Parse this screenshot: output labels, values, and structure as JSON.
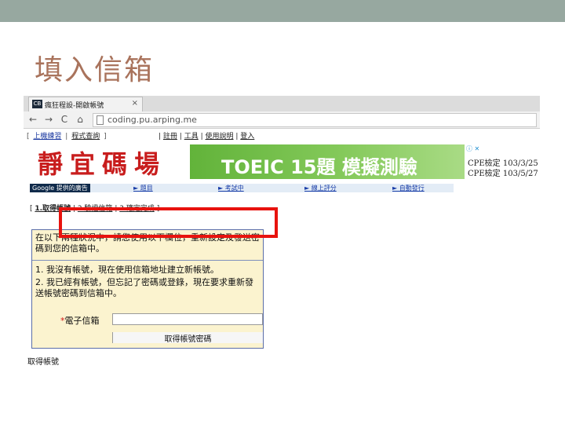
{
  "slide": {
    "title": "填入信箱"
  },
  "browser": {
    "tab_title": "瘋狂程設-開啟帳號",
    "favicon_text": "CB",
    "tab_close": "×",
    "nav": {
      "back": "←",
      "forward": "→",
      "reload": "C",
      "home": "⌂"
    },
    "url": "coding.pu.arping.me"
  },
  "site": {
    "top_links": [
      "上機練習",
      "程式查詢"
    ],
    "user_links": [
      "註冊",
      "工具",
      "使用說明",
      "登入"
    ],
    "logo": "靜宜碼場",
    "banner": "TOEIC 15題 模擬測驗",
    "ad_icons": "ⓘ ✕",
    "cpe_lines": [
      "CPE檢定 103/3/25",
      "CPE檢定 103/5/27"
    ],
    "google_ad_label": "Google 提供的廣告",
    "menu": [
      "► 題目",
      "► 考試中",
      "► 線上評分",
      "► 自動發行"
    ],
    "steps": [
      "1.取得帳號",
      "2.驗證信箱",
      "3.確定完成"
    ]
  },
  "form": {
    "intro": "在以下兩種狀況中，請您使用以下欄位，重新設定及發送密碼到您的信箱中。",
    "option1": "1. 我沒有帳號，現在使用信箱地址建立新帳號。",
    "option2": "2. 我已經有帳號，但忘記了密碼或登錄，現在要求重新發送帳號密碼到信箱中。",
    "email_required_mark": "*",
    "email_label": "電子信箱",
    "email_value": "",
    "submit_label": "取得帳號密碼"
  },
  "footer": {
    "text": "取得帳號"
  },
  "colors": {
    "highlight": "#e8130e",
    "title": "#a9735c",
    "banner": "#62b33a"
  }
}
